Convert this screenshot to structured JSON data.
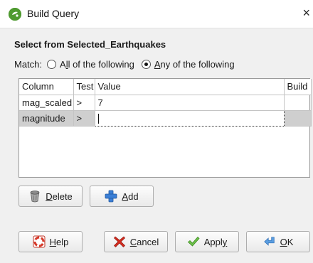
{
  "window": {
    "title": "Build Query",
    "close_glyph": "×",
    "icon": "app-logo-icon"
  },
  "heading": "Select from Selected_Earthquakes",
  "match": {
    "label": "Match:",
    "options": [
      {
        "prefix": "A",
        "mnemonic": "l",
        "suffix": "l of the following",
        "checked": false
      },
      {
        "prefix": "",
        "mnemonic": "A",
        "suffix": "ny of the following",
        "checked": true
      }
    ]
  },
  "table": {
    "columns": [
      "Column",
      "Test",
      "Value",
      "Build"
    ],
    "rows": [
      {
        "column": "mag_scaled",
        "test": ">",
        "value": "7",
        "build": "",
        "selected": false
      },
      {
        "column": "magnitude",
        "test": ">",
        "value": "",
        "build": "",
        "selected": true
      }
    ]
  },
  "buttons": {
    "delete": {
      "mnemonic": "D",
      "rest": "elete",
      "icon": "trash-icon"
    },
    "add": {
      "mnemonic": "A",
      "rest": "dd",
      "icon": "plus-icon"
    },
    "help": {
      "mnemonic": "H",
      "rest": "elp",
      "icon": "lifebuoy-icon"
    },
    "cancel": {
      "mnemonic": "C",
      "rest": "ancel",
      "icon": "red-x-icon"
    },
    "apply": {
      "prefix": "Appl",
      "mnemonic": "y",
      "icon": "checkmark-icon"
    },
    "ok": {
      "mnemonic": "O",
      "rest": "K",
      "icon": "enter-arrow-icon"
    }
  },
  "colors": {
    "selected_row": "#cfcfcf",
    "app_icon": "#4e9a2f",
    "dialog_bg": "#f0f0f0"
  }
}
